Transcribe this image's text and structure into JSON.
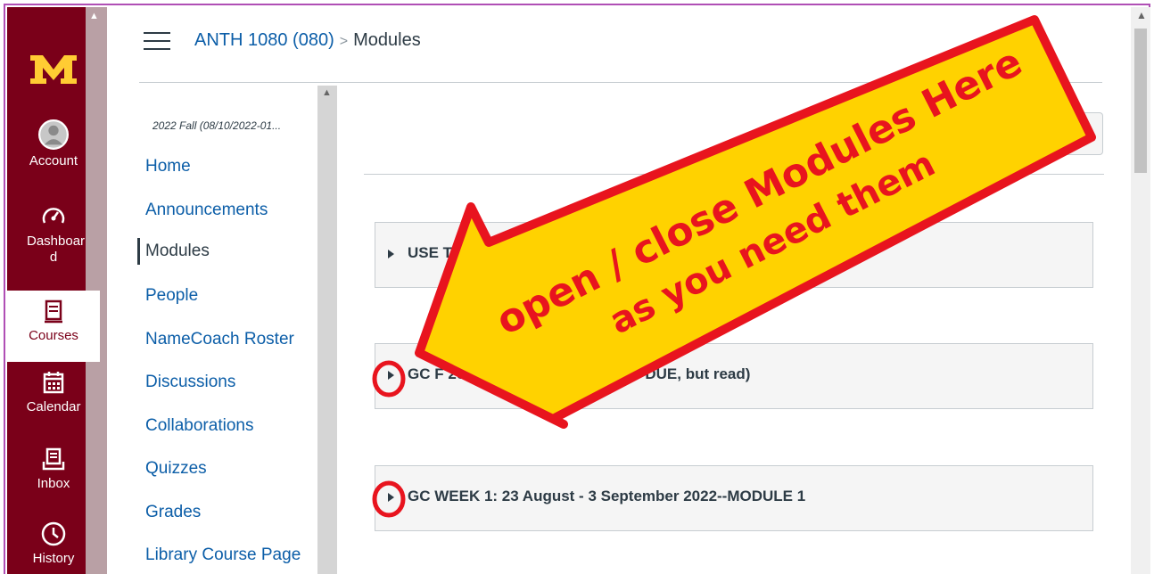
{
  "header": {
    "course": "ANTH 1080 (080)",
    "separator": ">",
    "current": "Modules"
  },
  "global_nav": {
    "logo": "M",
    "items": [
      {
        "label": "Account",
        "icon": "account-icon"
      },
      {
        "label": "Dashboar d",
        "icon": "dashboard-icon"
      },
      {
        "label": "Courses",
        "icon": "courses-icon",
        "active": true
      },
      {
        "label": "Calendar",
        "icon": "calendar-icon"
      },
      {
        "label": "Inbox",
        "icon": "inbox-icon"
      },
      {
        "label": "History",
        "icon": "history-icon"
      }
    ],
    "colors": {
      "brand": "#7a0019",
      "logo": "#ffcc33"
    }
  },
  "course_nav": {
    "term": "2022 Fall (08/10/2022-01...",
    "items": [
      {
        "label": "Home"
      },
      {
        "label": "Announcements"
      },
      {
        "label": "Modules",
        "active": true
      },
      {
        "label": "People"
      },
      {
        "label": "NameCoach Roster"
      },
      {
        "label": "Discussions"
      },
      {
        "label": "Collaborations"
      },
      {
        "label": "Quizzes"
      },
      {
        "label": "Grades"
      },
      {
        "label": "Library Course Page"
      }
    ]
  },
  "modules": [
    {
      "title": "USE T      \"CO                                           B ABOVE (If you do not, the firs..."
    },
    {
      "title": "GC F             2022 MEMOS (NOTHING IS DUE, but read)"
    },
    {
      "title": "GC WEEK 1: 23 August - 3 September 2022--MODULE 1"
    }
  ],
  "toolbar": {
    "more_label": "⋮"
  },
  "annotation": {
    "line1": "open / close Modules Here",
    "line2": "as you need them",
    "colors": {
      "fill": "#ffd200",
      "stroke": "#e8141e"
    }
  }
}
